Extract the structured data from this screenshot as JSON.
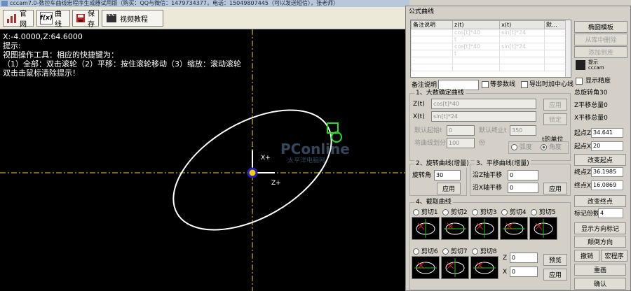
{
  "window": {
    "title": "cccam7.0-数控车曲线宏程序生成器试用版（购买：QQ与微信：1479734377，电话：15049807445（可以发送短信），张老师）"
  },
  "toolbar": {
    "website_label": "官网",
    "curve_label": "曲线",
    "curve_icon_text": "f(x)",
    "save_label": "保存",
    "video_label": "视频教程"
  },
  "canvas": {
    "coord_readout": "X:-4.0000,Z:64.6000",
    "hint_title": "提示:",
    "hint_line1": "视图操作工具：相应的快捷键为：",
    "hint_line2": "（1）全部：双击滚轮（2）平移：按住滚轮移动（3）缩放：滚动滚轮",
    "hint_line3": "双击击鼠标清除提示！",
    "axis_x_label": "X+",
    "axis_z_label": "Z+",
    "watermark_main": "PConline",
    "watermark_sub": "太平洋电脑网"
  },
  "panel": {
    "title": "公式曲线",
    "grid_columns": [
      "备注说明",
      "z(t)",
      "x(t)",
      "默..."
    ],
    "grid_rows": [
      [
        "",
        "cos[t]*40",
        "sin[t]*24",
        ""
      ],
      [
        "",
        "t",
        "",
        ""
      ],
      [
        "",
        "cos[t]*40",
        "sin[t]*24",
        ""
      ],
      [
        "",
        "t",
        "",
        ""
      ],
      [
        "",
        "",
        "",
        ""
      ],
      [
        "",
        "",
        "",
        ""
      ]
    ],
    "ellipse_template_btn": "椭圆模板",
    "delete_from_lib_btn": "从库中删除",
    "add_to_lib_btn": "添加到库",
    "logo_line1": "提示",
    "logo_line2": "cccam",
    "show_precision_label": "显示精度",
    "note_label": "备注说明",
    "equal_param_label": "等参数线",
    "export_centerline_label": "导出时加中心线",
    "section1_title": "1、大数确定曲线",
    "z_t_label": "Z(t)",
    "z_t_value": "cos[t]*40",
    "x_t_label": "X(t)",
    "x_t_value": "sin[t]*24",
    "apply_btn": "应用",
    "lock_btn": "锁定",
    "start_label": "默认起始t",
    "start_value": "0",
    "end_label": "默认终止t",
    "end_value": "350",
    "divide_label": "将曲线划分",
    "divide_value": "100",
    "divide_unit": "份",
    "unit_group_label": "t的单位",
    "unit_radian": "弧度",
    "unit_degree": "角度",
    "section2_title": "2、旋转曲线(增量)",
    "rot_angle_label": "旋转角",
    "rot_angle_value": "30",
    "rot_apply_btn": "应用",
    "section3_title": "3、平移曲线(增量)",
    "z_shift_label": "沿Z轴平移",
    "z_shift_value": "0",
    "x_shift_label": "沿X轴平移",
    "x_shift_value": "0",
    "shift_apply_btn": "应用",
    "section4_title": "4、截取曲线",
    "cuts": [
      "剪切1",
      "剪切2",
      "剪切3",
      "剪切4",
      "剪切5",
      "剪切6",
      "剪切7",
      "剪切8"
    ],
    "cut_z_label": "Z",
    "cut_z_value": "0",
    "cut_x_label": "X",
    "cut_x_value": "0",
    "preview_btn": "预览",
    "cut_apply_btn": "应用",
    "total_rot_label": "总旋转角30",
    "total_z_shift_label": "Z平移总量0",
    "total_x_shift_label": "X平移总量0",
    "start_z_label": "起点Z",
    "start_z_value": "34.641",
    "start_x_label": "起点X",
    "start_x_value": "20",
    "change_start_btn": "改变起点",
    "end_z_label": "终点Z",
    "end_z_value": "36.1985",
    "end_x_label": "终点X",
    "end_x_value": "16.0869",
    "change_end_btn": "改变终点",
    "mark_count_label": "标记份数",
    "mark_count_value": "4",
    "show_dir_btn": "显示方向标记",
    "reverse_dir_btn": "颠倒方向",
    "undo_btn": "撤销",
    "macro_btn": "宏程序",
    "redraw_btn": "重画",
    "confirm_btn": "确认"
  }
}
